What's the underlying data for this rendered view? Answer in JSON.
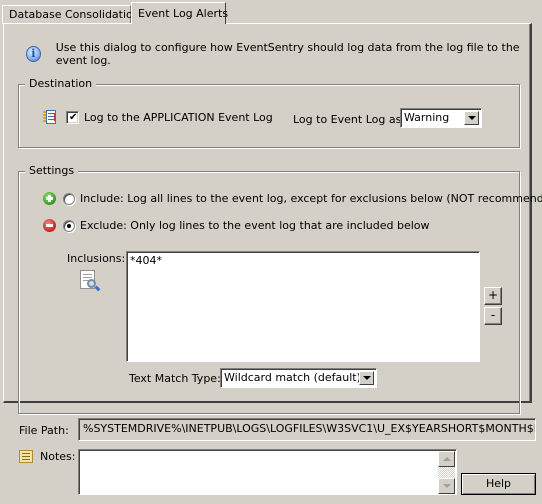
{
  "tabs": [
    {
      "label": "Database Consolidation",
      "active": false
    },
    {
      "label": "Event Log Alerts",
      "active": true
    }
  ],
  "info": {
    "icon": "info-icon",
    "text": "Use this dialog to configure how EventSentry should log data from the log file to the event log."
  },
  "destination": {
    "group_label": "Destination",
    "icon": "event-log-icon",
    "checkbox_label": "Log to the APPLICATION Event Log",
    "checked": true,
    "log_as_label": "Log to Event Log as:",
    "log_as_value": "Warning"
  },
  "settings": {
    "group_label": "Settings",
    "include": {
      "icon": "plus-circle-icon",
      "label": "Include: Log all lines to the event log, except for exclusions below (NOT recommended)",
      "selected": false
    },
    "exclude": {
      "icon": "minus-circle-icon",
      "label": "Exclude: Only log lines to the event log that are included below",
      "selected": true
    },
    "inclusions_label": "Inclusions:",
    "inclusions_value": "*404*",
    "add_button": "+",
    "remove_button": "-",
    "text_match_label": "Text Match Type:",
    "text_match_value": "Wildcard match (default)"
  },
  "file_path": {
    "label": "File Path:",
    "value": "%SYSTEMDRIVE%\\INETPUB\\LOGS\\LOGFILES\\W3SVC1\\U_EX$YEARSHORT$MONTH$DAY.LOG"
  },
  "notes": {
    "label": "Notes:",
    "value": ""
  },
  "help_button": "Help"
}
